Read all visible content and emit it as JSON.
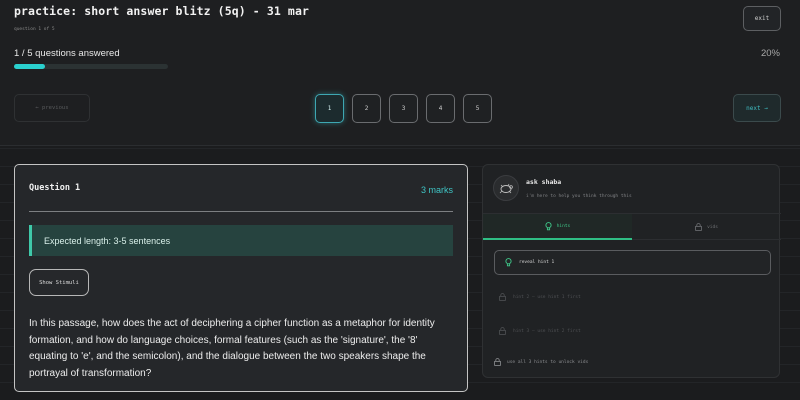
{
  "header": {
    "title": "practice: short answer blitz (5q) - 31 mar",
    "question_of": "question 1 of 5",
    "exit_label": "exit"
  },
  "progress": {
    "answered_text": "1 / 5 questions answered",
    "percent_text": "20%",
    "fraction": 0.2
  },
  "nav": {
    "previous_label": "← previous",
    "next_label": "next →",
    "questions": [
      "1",
      "2",
      "3",
      "4",
      "5"
    ],
    "active_index": 0
  },
  "question": {
    "title": "Question 1",
    "marks": "3 marks",
    "expected_length": "Expected length: 3-5 sentences",
    "stimuli_button": "Show Stimuli",
    "text": "In this passage, how does the act of deciphering a cipher function as a metaphor for identity formation, and how do language choices, formal features (such as the 'signature', the '8' equating to 'e', and the semicolon), and the dialogue between the two speakers shape the portrayal of transformation?"
  },
  "chat": {
    "name": "ask shaba",
    "subtitle": "i'm here to help you think through this",
    "tabs": {
      "hints": "hints",
      "vids": "vids"
    },
    "reveal_hint": "reveal hint 1",
    "locked_hints": [
      "hint 2 — use hint 1 first",
      "hint 3 — use hint 2 first"
    ],
    "unlock_note": "use all 3 hints to unlock vids"
  },
  "colors": {
    "accent": "#2ad0ce",
    "hint_green": "#3fc98a",
    "expected_bg": "#26433f"
  }
}
